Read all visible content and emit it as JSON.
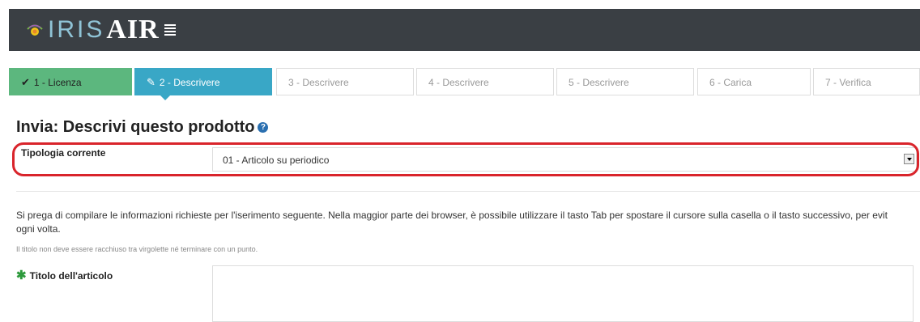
{
  "header": {
    "logo_iris": "IRIS",
    "logo_air": "AIR",
    "brand_colors": {
      "bar": "#3a3f44",
      "iris": "#8fc3d6",
      "air": "#ffffff",
      "accent": "#e8862a"
    }
  },
  "steps": [
    {
      "label": "1 - Licenza",
      "state": "done",
      "icon": "check-icon"
    },
    {
      "label": "2 - Descrivere",
      "state": "active",
      "icon": "edit-icon"
    },
    {
      "label": "3 - Descrivere",
      "state": "pending"
    },
    {
      "label": "4 - Descrivere",
      "state": "pending"
    },
    {
      "label": "5 - Descrivere",
      "state": "pending"
    },
    {
      "label": "6 - Carica",
      "state": "pending"
    },
    {
      "label": "7 - Verifica",
      "state": "pending"
    }
  ],
  "page": {
    "title": "Invia: Descrivi questo prodotto",
    "help_icon": "?"
  },
  "type_field": {
    "label": "Tipologia corrente",
    "value": "01 - Articolo su periodico"
  },
  "instructions": {
    "line1": "Si prega di compilare le informazioni richieste per l'iserimento seguente. Nella maggior parte dei browser, è possibile utilizzare il tasto Tab per spostare il cursore sulla casella o il tasto successivo, per evit",
    "line2": "ogni volta.",
    "note": "Il titolo non deve essere racchiuso tra virgolette né terminare con un punto."
  },
  "title_field": {
    "required_mark": "✱",
    "label": "Titolo dell'articolo",
    "value": ""
  },
  "colors": {
    "step_done": "#5cb77e",
    "step_active": "#39a7c6",
    "highlight": "#d9242b",
    "required": "#2d9a3c"
  }
}
